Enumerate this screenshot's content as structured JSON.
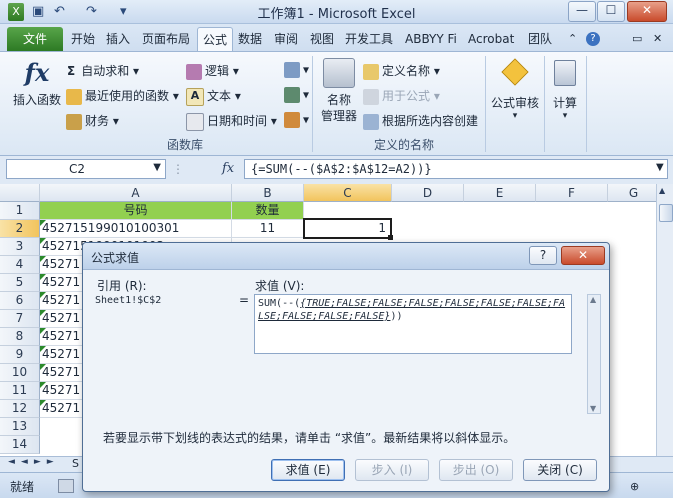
{
  "window": {
    "title": "工作簿1 - Microsoft Excel",
    "controls": {
      "minimize": "—",
      "maximize": "☐",
      "close": "✕"
    }
  },
  "quick_access": {
    "save_icon": "save-icon",
    "undo_icon": "undo-icon",
    "redo_icon": "redo-icon"
  },
  "tabs": {
    "file": "文件",
    "items": [
      "开始",
      "插入",
      "页面布局",
      "公式",
      "数据",
      "审阅",
      "视图",
      "开发工具",
      "ABBYY Fi",
      "Acrobat",
      "团队"
    ],
    "active": "公式",
    "right_icons": {
      "help": "?",
      "restore": "▭",
      "close": "✕"
    }
  },
  "ribbon": {
    "insert_function": {
      "icon": "fx",
      "label": "插入函数"
    },
    "autosum": "自动求和",
    "recent": "最近使用的函数",
    "financial": "财务",
    "logical": "逻辑",
    "text": "文本",
    "datetime": "日期和时间",
    "group_function_library": "函数库",
    "name_manager": "名称\n管理器",
    "define_name": "定义名称",
    "use_in_formula": "用于公式",
    "create_from_selection": "根据所选内容创建",
    "group_defined_names": "定义的名称",
    "formula_auditing": "公式审核",
    "calculation": "计算"
  },
  "formula_bar": {
    "name_box": "C2",
    "fx": "fx",
    "formula": "{=SUM(--($A$2:$A$12=A2))}"
  },
  "sheet": {
    "columns": [
      "A",
      "B",
      "C",
      "D",
      "E",
      "F",
      "G"
    ],
    "rows": [
      "1",
      "2",
      "3",
      "4",
      "5",
      "6",
      "7",
      "8",
      "9",
      "10",
      "11",
      "12",
      "13",
      "14"
    ],
    "header_A": "号码",
    "header_B": "数量",
    "A2": "452715199010100301",
    "B2": "11",
    "C2": "1",
    "partial_prefix": "45271",
    "A3_visible": "4527151990101003",
    "active_cell": "C2"
  },
  "sheet_tabs": {
    "nav": [
      "◄",
      "◄",
      "►",
      "►"
    ],
    "sheet_stub": "S"
  },
  "status": {
    "ready": "就绪"
  },
  "dialog": {
    "title": "公式求值",
    "ref_label": "引用 (R):",
    "ref_value": "Sheet1!$C$2",
    "equals": "=",
    "val_label": "求值 (V):",
    "val_prefix": "SUM(--(",
    "val_underlined": "{TRUE;FALSE;FALSE;FALSE;FALSE;FALSE;FALSE;FALSE;FALSE;FALSE;FALSE}",
    "val_suffix": "))",
    "hint": "若要显示带下划线的表达式的结果，请单击 “求值”。最新结果将以斜体显示。",
    "buttons": {
      "evaluate": "求值 (E)",
      "step_in": "步入 (I)",
      "step_out": "步出 (O)",
      "close": "关闭 (C)"
    },
    "help": "?",
    "close_x": "✕"
  }
}
